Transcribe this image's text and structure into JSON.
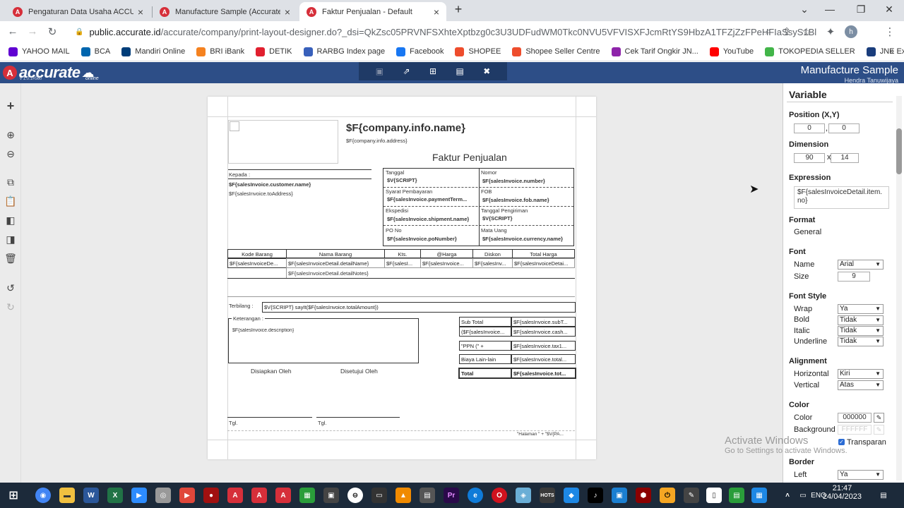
{
  "browser": {
    "tabs": [
      {
        "label": "Pengaturan Data Usaha ACCURA",
        "active": false
      },
      {
        "label": "Manufacture Sample (Accurate O",
        "active": false
      },
      {
        "label": "Faktur Penjualan - Default",
        "active": true
      }
    ],
    "url_host": "public.accurate.id",
    "url_path": "/accurate/company/print-layout-designer.do?_dsi=QkZsc05PRVNFSXhteXptbzg0c3U3UDFudWM0Tkc0NVU5VFVISXFJcmRtYS9HbzA1TFZjZzFPeHFIaSsyS1BlZw...",
    "profile_initial": "h",
    "bookmarks": [
      {
        "label": "YAHOO MAIL",
        "color": "#6001d2"
      },
      {
        "label": "BCA",
        "color": "#0066ae"
      },
      {
        "label": "Mandiri Online",
        "color": "#003d79"
      },
      {
        "label": "BRI iBank",
        "color": "#f58220"
      },
      {
        "label": "DETIK",
        "color": "#e1202f"
      },
      {
        "label": "RARBG Index page",
        "color": "#3860bb"
      },
      {
        "label": "Facebook",
        "color": "#1877f2"
      },
      {
        "label": "SHOPEE",
        "color": "#ee4d2d"
      },
      {
        "label": "Shopee Seller Centre",
        "color": "#ee4d2d"
      },
      {
        "label": "Cek Tarif Ongkir JN...",
        "color": "#8e24aa"
      },
      {
        "label": "YouTube",
        "color": "#ff0000"
      },
      {
        "label": "TOKOPEDIA SELLER",
        "color": "#42b549"
      },
      {
        "label": "JNE Express",
        "color": "#1a3d7c"
      }
    ]
  },
  "app": {
    "logo_text": "accurate",
    "logo_sub": "online",
    "version": "v 1.0.1#560",
    "company": "Manufacture Sample",
    "user": "Hendra Tanuwijaya"
  },
  "invoice": {
    "company_name": "$F{company.info.name}",
    "company_address": "$F{company.info.address}",
    "title": "Faktur Penjualan",
    "kepada_label": "Kepada :",
    "customer_name": "$F{salesInvoice.customer.name}",
    "to_address": "$F{salesInvoice.toAddress}",
    "info_cells": [
      {
        "label": "Tanggal",
        "value": "$V{SCRIPT}"
      },
      {
        "label": "Nomor",
        "value": "$F{salesInvoice.number}"
      },
      {
        "label": "Syarat Pembayaran",
        "value": "$F{salesInvoice.paymentTerm..."
      },
      {
        "label": "FOB",
        "value": "$F{salesInvoice.fob.name}"
      },
      {
        "label": "Ekspedisi",
        "value": "$F{salesInvoice.shipment.name}"
      },
      {
        "label": "Tanggal Pengiriman",
        "value": "$V{SCRIPT}"
      },
      {
        "label": "PO No",
        "value": "$F{salesInvoice.poNumber}"
      },
      {
        "label": "Mata Uang",
        "value": "$F{salesInvoice.currency.name}"
      }
    ],
    "columns": [
      "Kode Barang",
      "Nama Barang",
      "Kts.",
      "@Harga",
      "Diskon",
      "Total Harga"
    ],
    "row_cells": [
      "$F{salesInvoiceDe...",
      "$F{salesInvoiceDetail.detailName}",
      "$F{salesI...",
      "$F{salesInvoice...",
      "$F{salesInv...",
      "$F{salesInvoiceDetai..."
    ],
    "detail_notes": "$F{salesInvoiceDetail.detailNotes}",
    "terbilang_label": "Terbilang :",
    "terbilang_value": "$V{SCRIPT} sayIt($F{salesInvoice.totalAmount})",
    "keterangan_label": "Keterangan :",
    "description": "$F{salesInvoice.description}",
    "disiapkan": "Disiapkan Oleh",
    "disetujui": "Disetujui Oleh",
    "tgl1": "Tgl.",
    "tgl2": "Tgl.",
    "totals": [
      {
        "label": "Sub Total",
        "value": "$F{salesInvoice.subT..."
      },
      {
        "label": "($F{salesInvoice...",
        "value": "$F{salesInvoice.cash..."
      },
      {
        "label": "\"PPN (\" +",
        "value": "$F{salesInvoice.tax1..."
      },
      {
        "label": "Biaya Lain-lain",
        "value": "$F{salesInvoice.total..."
      },
      {
        "label": "Total",
        "value": "$F{salesInvoice.tot..."
      }
    ],
    "footer_page": "\"Halaman \" + \"$V{PA..."
  },
  "panel": {
    "title": "Variable",
    "position_label": "Position (X,Y)",
    "pos_x": "0",
    "pos_y": "0",
    "dimension_label": "Dimension",
    "dim_w": "90",
    "dim_x": "x",
    "dim_h": "14",
    "expression_label": "Expression",
    "expression": "$F{salesInvoiceDetail.item.no}",
    "format_label": "Format",
    "format_value": "General",
    "font_label": "Font",
    "name_label": "Name",
    "name_value": "Arial",
    "size_label": "Size",
    "size_value": "9",
    "fontstyle_label": "Font Style",
    "wrap_label": "Wrap",
    "wrap_value": "Ya",
    "bold_label": "Bold",
    "bold_value": "Tidak",
    "italic_label": "Italic",
    "italic_value": "Tidak",
    "underline_label": "Underline",
    "underline_value": "Tidak",
    "alignment_label": "Alignment",
    "horizontal_label": "Horizontal",
    "horizontal_value": "Kiri",
    "vertical_label": "Vertical",
    "vertical_value": "Atas",
    "color_label": "Color",
    "color_sub_label": "Color",
    "color_value": "000000",
    "background_label": "Background",
    "background_value": "FFFFFF",
    "transparan_label": "Transparan",
    "border_label": "Border",
    "left_label": "Left",
    "left_value": "Ya"
  },
  "watermark": {
    "line1": "Activate Windows",
    "line2": "Go to Settings to activate Windows."
  },
  "taskbar": {
    "lang": "ENG",
    "time": "21:47",
    "date": "24/04/2023"
  }
}
